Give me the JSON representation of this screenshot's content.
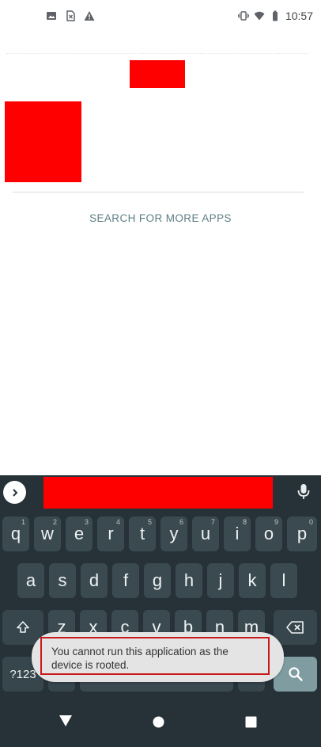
{
  "status_bar": {
    "time": "10:57",
    "left_icons": [
      "image-icon",
      "sim-card-icon",
      "warning-icon"
    ],
    "right_icons": [
      "vibrate-icon",
      "wifi-icon",
      "battery-icon"
    ]
  },
  "content": {
    "search_more_label": "SEARCH FOR MORE APPS"
  },
  "keyboard": {
    "row1": [
      {
        "key": "q",
        "hint": "1"
      },
      {
        "key": "w",
        "hint": "2"
      },
      {
        "key": "e",
        "hint": "3"
      },
      {
        "key": "r",
        "hint": "4"
      },
      {
        "key": "t",
        "hint": "5"
      },
      {
        "key": "y",
        "hint": "6"
      },
      {
        "key": "u",
        "hint": "7"
      },
      {
        "key": "i",
        "hint": "8"
      },
      {
        "key": "o",
        "hint": "9"
      },
      {
        "key": "p",
        "hint": "0"
      }
    ],
    "row2": [
      "a",
      "s",
      "d",
      "f",
      "g",
      "h",
      "j",
      "k",
      "l"
    ],
    "row3": [
      "z",
      "x",
      "c",
      "v",
      "b",
      "n",
      "m"
    ],
    "symbols_label": "?123",
    "shift_icon": "shift-icon",
    "backspace_icon": "backspace-icon",
    "search_icon": "search-icon",
    "mic_icon": "mic-icon",
    "expand_icon": "chevron-right-icon"
  },
  "toast": {
    "message": "You cannot run this application as the device is rooted."
  },
  "nav_bar": {
    "icons": [
      "back-icon",
      "home-icon",
      "recents-icon"
    ]
  },
  "colors": {
    "keyboard_bg": "#263238",
    "key_bg": "#3b4a51",
    "action_key": "#7f9da1",
    "link_text": "#5e7f84",
    "redaction": "#ff0000",
    "toast_border": "#c81a1a"
  }
}
